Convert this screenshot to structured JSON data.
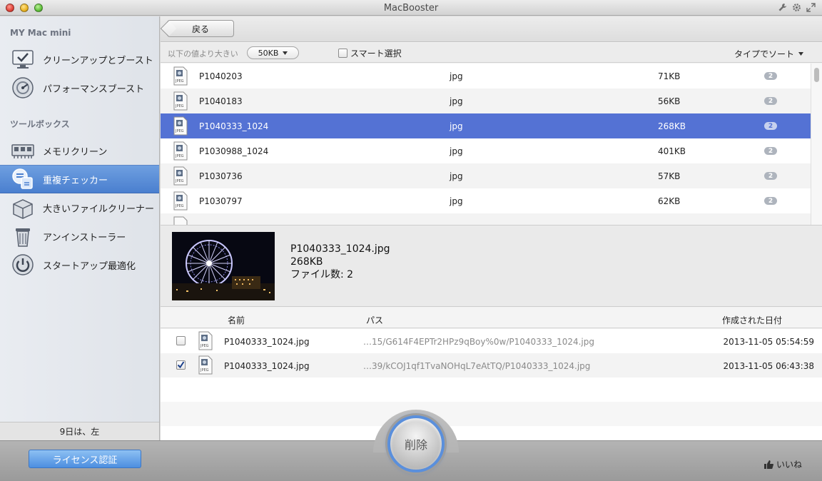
{
  "window": {
    "title": "MacBooster"
  },
  "sidebar": {
    "section_mac": "MY Mac mini",
    "section_toolbox": "ツールボックス",
    "items": [
      {
        "label": "クリーンアップとブースト",
        "icon": "monitor-check-icon",
        "active": false
      },
      {
        "label": "パフォーマンスブースト",
        "icon": "disk-gauge-icon",
        "active": false
      },
      {
        "label": "メモリクリーン",
        "icon": "memory-chip-icon",
        "active": false
      },
      {
        "label": "重複チェッカー",
        "icon": "duplicate-files-icon",
        "active": true
      },
      {
        "label": "大きいファイルクリーナー",
        "icon": "box-icon",
        "active": false
      },
      {
        "label": "アンインストーラー",
        "icon": "trash-icon",
        "active": false
      },
      {
        "label": "スタートアップ最適化",
        "icon": "power-icon",
        "active": false
      }
    ],
    "footer_text": "9日は、左"
  },
  "toolbar": {
    "back_label": "戻る"
  },
  "filter": {
    "label": "以下の値より大きい",
    "size_value": "50KB",
    "smart_select_label": "スマート選択",
    "sort_label": "タイプでソート"
  },
  "files": [
    {
      "name": "P1040203",
      "type": "jpg",
      "size": "71KB",
      "count": "2"
    },
    {
      "name": "P1040183",
      "type": "jpg",
      "size": "56KB",
      "count": "2"
    },
    {
      "name": "P1040333_1024",
      "type": "jpg",
      "size": "268KB",
      "count": "2"
    },
    {
      "name": "P1030988_1024",
      "type": "jpg",
      "size": "401KB",
      "count": "2"
    },
    {
      "name": "P1030736",
      "type": "jpg",
      "size": "57KB",
      "count": "2"
    },
    {
      "name": "P1030797",
      "type": "jpg",
      "size": "62KB",
      "count": "2"
    }
  ],
  "preview": {
    "filename": "P1040333_1024.jpg",
    "size": "268KB",
    "count_text": "ファイル数: 2"
  },
  "details": {
    "headers": {
      "name": "名前",
      "path": "パス",
      "date": "作成された日付"
    },
    "rows": [
      {
        "checked": false,
        "name": "P1040333_1024.jpg",
        "path": "…15/G614F4EPTr2HPz9qBoy%0w/P1040333_1024.jpg",
        "date": "2013-11-05 05:54:59"
      },
      {
        "checked": true,
        "name": "P1040333_1024.jpg",
        "path": "…39/kCOJ1qf1TvaNOHqL7eAtTQ/P1040333_1024.jpg",
        "date": "2013-11-05 06:43:38"
      }
    ]
  },
  "bottom": {
    "license_label": "ライセンス認証",
    "delete_label": "削除",
    "like_label": "いいね"
  },
  "colors": {
    "accent": "#5472d4",
    "sidebar_active": "#4a7fcf",
    "license": "#4d8fe0"
  }
}
